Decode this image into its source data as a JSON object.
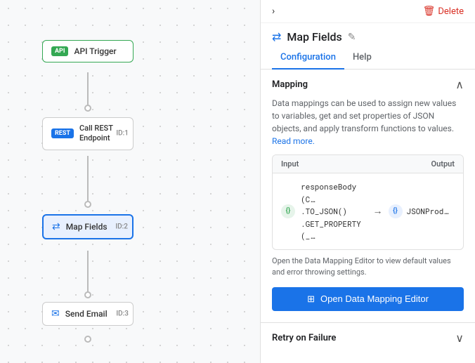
{
  "canvas": {
    "nodes": [
      {
        "id": "api-trigger",
        "label": "API Trigger",
        "badge": "API",
        "type": "api"
      },
      {
        "id": "rest-endpoint",
        "label1": "Call REST",
        "label2": "Endpoint",
        "badge": "REST",
        "idLabel": "ID:1",
        "type": "rest"
      },
      {
        "id": "map-fields",
        "label": "Map Fields",
        "idLabel": "ID:2",
        "type": "map"
      },
      {
        "id": "send-email",
        "label": "Send Email",
        "idLabel": "ID:3",
        "type": "email"
      }
    ]
  },
  "panel": {
    "breadcrumb_icon": "›",
    "delete_label": "Delete",
    "title": "Map Fields",
    "edit_icon": "✎",
    "tabs": [
      {
        "label": "Configuration",
        "active": true
      },
      {
        "label": "Help",
        "active": false
      }
    ],
    "mapping_section": {
      "title": "Mapping",
      "description": "Data mappings can be used to assign new values to variables, get and set properties of JSON objects, and apply transform functions to values.",
      "read_more": "Read more.",
      "table": {
        "input_header": "Input",
        "output_header": "Output",
        "row": {
          "input_line1": "responseBody (C…",
          "input_line2": ".TO_JSON()",
          "input_line3": ".GET_PROPERTY (_…",
          "arrow": "→",
          "output_label": "JSONProd…"
        }
      },
      "note": "Open the Data Mapping Editor to view default values and error throwing settings.",
      "open_editor_btn": "Open Data Mapping Editor"
    },
    "retry_section": {
      "title": "Retry on Failure"
    }
  }
}
